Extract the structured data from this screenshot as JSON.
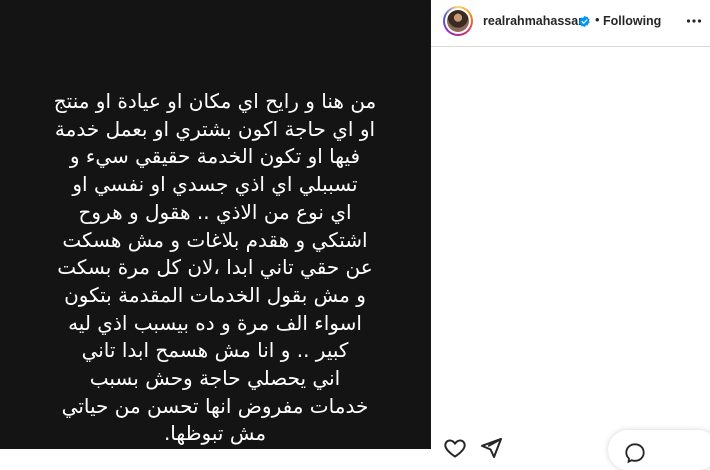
{
  "post": {
    "caption_lines": [
      "من هنا و رايح اي مكان او عيادة او منتج",
      "او اي حاجة اكون بشتري او بعمل خدمة",
      "فيها  او تكون الخدمة حقيقي سيء و",
      "تسببلي اي اذي جسدي او نفسي او",
      "اي نوع من الاذي .. هقول و هروح",
      "اشتكي و هقدم بلاغات و مش هسكت",
      "عن حقي تاني ابدا ،لان كل مرة بسكت",
      "و مش بقول الخدمات المقدمة بتكون",
      "اسواء الف مرة  و ده بيسبب اذي ليه",
      "كبير .. و انا مش هسمح ابدا تاني",
      "اني يحصلي حاجة وحش بسبب",
      "خدمات مفروض انها تحسن من حياتي",
      "مش تبوظها."
    ]
  },
  "header": {
    "username": "realrahmahassan",
    "separator": "•",
    "follow_status": "Following",
    "verified_icon": "verified-badge-icon",
    "more_icon": "more-options-icon"
  },
  "actions": {
    "like_icon": "heart-icon",
    "share_icon": "paper-plane-icon",
    "message_icon": "message-bubble-icon"
  },
  "colors": {
    "media_background": "#141414",
    "verified_blue": "#0095f6",
    "text_dark": "#262626"
  }
}
